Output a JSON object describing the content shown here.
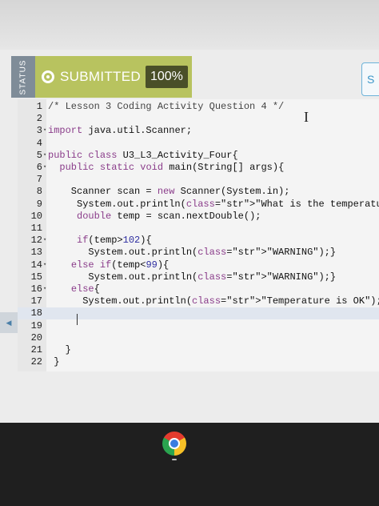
{
  "status": {
    "tab_label": "STATUS",
    "result_label": "SUBMITTED",
    "score": "100%",
    "accent_color": "#b8c35f",
    "right_button_label": "S"
  },
  "side_marker_label": "◀",
  "editor": {
    "lines": [
      {
        "n": "1",
        "fold": "",
        "text": "/* Lesson 3 Coding Activity Question 4 */"
      },
      {
        "n": "2",
        "fold": "",
        "text": ""
      },
      {
        "n": "3",
        "fold": "▾",
        "text": "import java.util.Scanner;"
      },
      {
        "n": "4",
        "fold": "",
        "text": ""
      },
      {
        "n": "5",
        "fold": "▾",
        "text": "public class U3_L3_Activity_Four{"
      },
      {
        "n": "6",
        "fold": "▾",
        "text": "  public static void main(String[] args){"
      },
      {
        "n": "7",
        "fold": "",
        "text": ""
      },
      {
        "n": "8",
        "fold": "",
        "text": "    Scanner scan = new Scanner(System.in);"
      },
      {
        "n": "9",
        "fold": "",
        "text": "     System.out.println(\"What is the temperature?\");"
      },
      {
        "n": "10",
        "fold": "",
        "text": "     double temp = scan.nextDouble();"
      },
      {
        "n": "11",
        "fold": "",
        "text": ""
      },
      {
        "n": "12",
        "fold": "▾",
        "text": "     if(temp>102){"
      },
      {
        "n": "13",
        "fold": "",
        "text": "       System.out.println(\"WARNING\");}"
      },
      {
        "n": "14",
        "fold": "▾",
        "text": "    else if(temp<99){"
      },
      {
        "n": "15",
        "fold": "",
        "text": "       System.out.println(\"WARNING\");}"
      },
      {
        "n": "16",
        "fold": "▾",
        "text": "    else{"
      },
      {
        "n": "17",
        "fold": "",
        "text": "      System.out.println(\"Temperature is OK\");}"
      },
      {
        "n": "18",
        "fold": "",
        "text": ""
      },
      {
        "n": "19",
        "fold": "",
        "text": ""
      },
      {
        "n": "20",
        "fold": "",
        "text": ""
      },
      {
        "n": "21",
        "fold": "",
        "text": "   }"
      },
      {
        "n": "22",
        "fold": "",
        "text": " }"
      }
    ],
    "active_line": "18"
  },
  "taskbar": {
    "app_icon": "chrome-icon"
  }
}
